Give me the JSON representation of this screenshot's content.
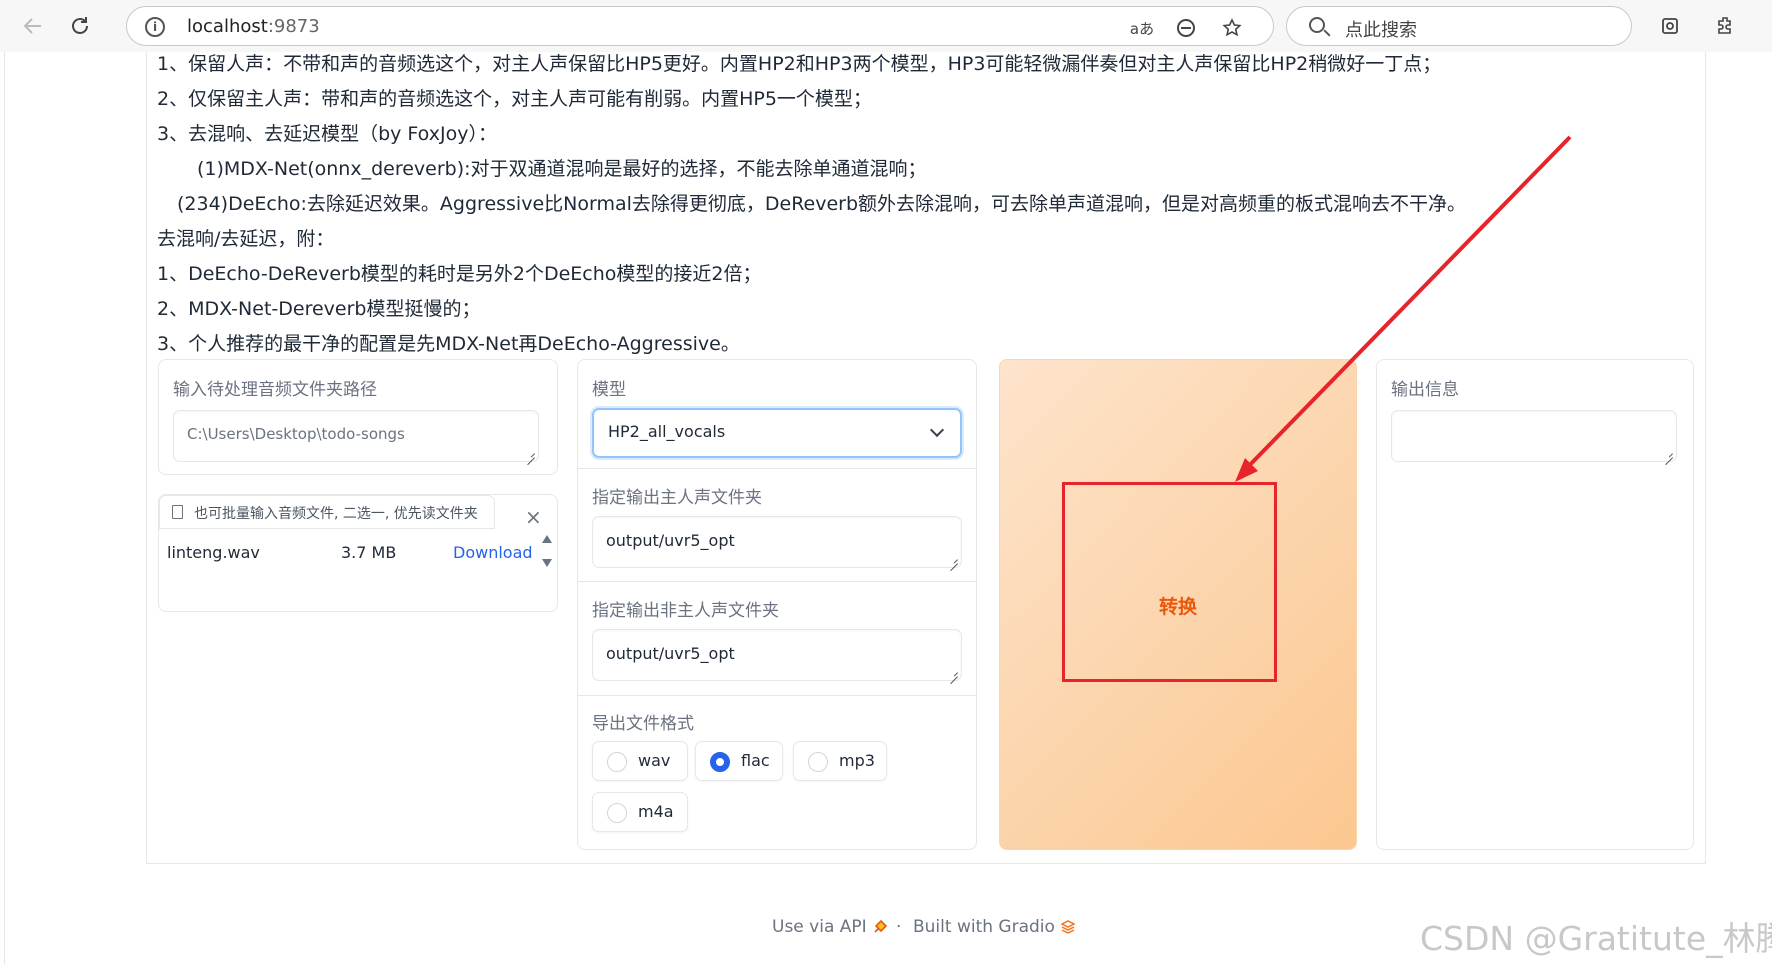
{
  "browser": {
    "url_host": "localhost",
    "url_port": ":9873",
    "search_placeholder": "点此搜索",
    "read_aloud_label": "aあ"
  },
  "instructions": [
    "1、保留人声：不带和声的音频选这个，对主人声保留比HP5更好。内置HP2和HP3两个模型，HP3可能轻微漏伴奏但对主人声保留比HP2稍微好一丁点；",
    "2、仅保留主人声：带和声的音频选这个，对主人声可能有削弱。内置HP5一个模型；",
    "3、去混响、去延迟模型（by FoxJoy）：",
    "(1)MDX-Net(onnx_dereverb):对于双通道混响是最好的选择，不能去除单通道混响；",
    "(234)DeEcho:去除延迟效果。Aggressive比Normal去除得更彻底，DeReverb额外去除混响，可去除单声道混响，但是对高频重的板式混响去不干净。",
    "去混响/去延迟，附：",
    "1、DeEcho-DeReverb模型的耗时是另外2个DeEcho模型的接近2倍；",
    "2、MDX-Net-Dereverb模型挺慢的；",
    "3、个人推荐的最干净的配置是先MDX-Net再DeEcho-Aggressive。"
  ],
  "input_folder": {
    "label": "输入待处理音频文件夹路径",
    "placeholder": "C:\\Users\\Desktop\\todo-songs"
  },
  "file_upload": {
    "header": "也可批量输入音频文件, 二选一, 优先读文件夹",
    "file_name": "linteng.wav",
    "file_size": "3.7 MB",
    "download_label": "Download",
    "close_label": "×"
  },
  "model": {
    "label": "模型",
    "selected": "HP2_all_vocals"
  },
  "vocal_output": {
    "label": "指定输出主人声文件夹",
    "value": "output/uvr5_opt"
  },
  "instrumental_output": {
    "label": "指定输出非主人声文件夹",
    "value": "output/uvr5_opt"
  },
  "format": {
    "label": "导出文件格式",
    "options": [
      "wav",
      "flac",
      "mp3",
      "m4a"
    ],
    "selected": "flac"
  },
  "convert_button": {
    "label": "转换"
  },
  "output_info": {
    "label": "输出信息",
    "value": ""
  },
  "footer": {
    "api_label": "Use via API",
    "separator": "·",
    "built_label": "Built with Gradio"
  },
  "watermark": "CSDN @Gratitute_林腾",
  "colors": {
    "accent_blue": "#2563eb",
    "button_orange": "#ea580c",
    "annotation_red": "#e8242b"
  }
}
